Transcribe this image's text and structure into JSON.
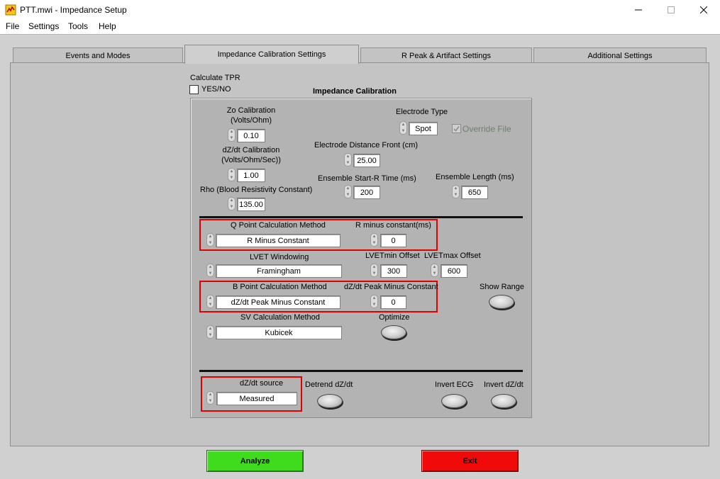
{
  "window": {
    "title": "PTT.mwi - Impedance Setup",
    "minimize": "—",
    "maximize": "☐",
    "close": "✕"
  },
  "menu": [
    "File",
    "Settings",
    "Tools",
    "Help"
  ],
  "tabs": [
    "Events and Modes",
    "Impedance Calibration Settings",
    "R Peak & Artifact Settings",
    "Additional Settings"
  ],
  "tpr": {
    "label": "Calculate TPR",
    "checkbox_label": "YES/NO",
    "checked": false
  },
  "section_title": "Impedance Calibration",
  "calibration": {
    "zo_label_1": "Zo Calibration",
    "zo_label_2": "(Volts/Ohm)",
    "zo_value": "0.10",
    "dzdt_label_1": "dZ/dt Calibration",
    "dzdt_label_2": "(Volts/Ohm/Sec))",
    "dzdt_value": "1.00",
    "rho_label": "Rho (Blood Resistivity Constant)",
    "rho_value": "135.00",
    "electrode_type_label": "Electrode Type",
    "electrode_type_value": "Spot",
    "override_label": "Override File",
    "override_checked": true,
    "distance_label": "Electrode Distance Front (cm)",
    "distance_value": "25.00",
    "ensemble_start_label": "Ensemble Start-R Time (ms)",
    "ensemble_start_value": "200",
    "ensemble_length_label": "Ensemble Length (ms)",
    "ensemble_length_value": "650"
  },
  "methods": {
    "q_point_label": "Q Point Calculation Method",
    "q_point_value": "R Minus Constant",
    "r_minus_label": "R minus constant(ms)",
    "r_minus_value": "0",
    "lvet_label": "LVET Windowing",
    "lvet_value": "Framingham",
    "lvetmin_label": "LVETmin Offset",
    "lvetmin_value": "300",
    "lvetmax_label": "LVETmax Offset",
    "lvetmax_value": "600",
    "b_point_label": "B Point Calculation Method",
    "b_point_value": "dZ/dt Peak Minus Constant",
    "dzdt_peak_label": "dZ/dt Peak Minus Constant",
    "dzdt_peak_value": "0",
    "show_range_label": "Show Range",
    "sv_label": "SV Calculation Method",
    "sv_value": "Kubicek",
    "optimize_label": "Optimize"
  },
  "source": {
    "dzdt_source_label": "dZ/dt source",
    "dzdt_source_value": "Measured",
    "detrend_label": "Detrend dZ/dt",
    "invert_ecg_label": "Invert ECG",
    "invert_dzdt_label": "Invert dZ/dt"
  },
  "buttons": {
    "analyze": "Analyze",
    "exit": "Exit"
  },
  "colors": {
    "analyze": "#3fdc1e",
    "exit": "#f00a0a",
    "highlight": "#e00000"
  }
}
